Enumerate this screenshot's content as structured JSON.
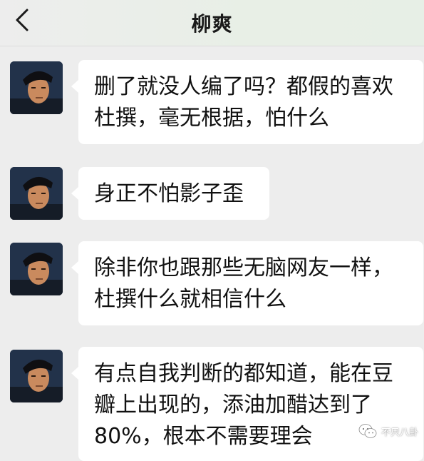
{
  "header": {
    "title": "柳爽",
    "back_icon": "chevron-left-icon"
  },
  "messages": [
    {
      "line1": "删了就没人编了吗？都假的喜欢",
      "line2": "杜撰，毫无根据，怕什么"
    },
    {
      "line1": "身正不怕影子歪"
    },
    {
      "line1": "除非你也跟那些无脑网友一样，",
      "line2": "杜撰什么就相信什么"
    },
    {
      "line1": "有点自我判断的都知道，能在豆",
      "line2": "瓣上出现的，添油加醋达到了",
      "line3": "80%，根本不需要理会"
    }
  ],
  "watermark": {
    "text": "不只八卦",
    "icon": "wechat-logo-icon"
  },
  "colors": {
    "background": "#ededed",
    "bubble": "#ffffff"
  }
}
